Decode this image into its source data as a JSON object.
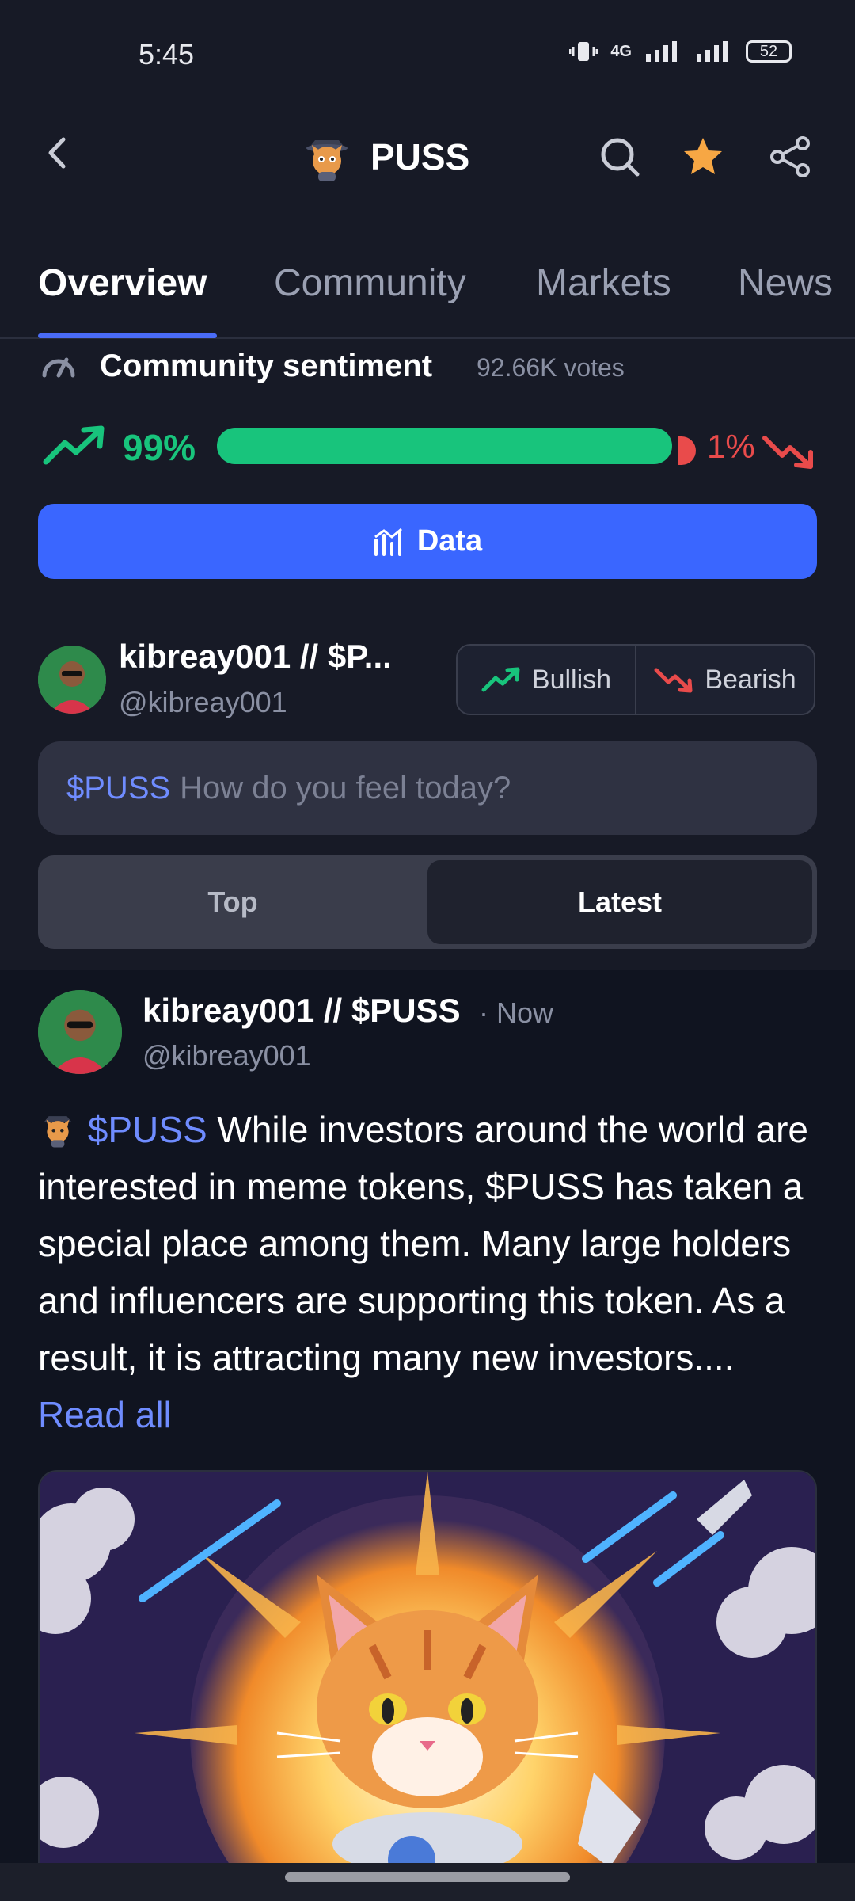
{
  "status": {
    "time": "5:45",
    "network": "4G",
    "battery": "52"
  },
  "header": {
    "title": "PUSS"
  },
  "tabs": [
    "Overview",
    "Community",
    "Markets",
    "News"
  ],
  "sentiment": {
    "title": "Community sentiment",
    "votes": "92.66K votes",
    "bullish_pct": "99%",
    "bearish_pct": "1%",
    "bullish_fraction": 0.99
  },
  "data_button": "Data",
  "composer": {
    "user_name": "kibreay001 // $P...",
    "user_handle": "@kibreay001",
    "bullish_label": "Bullish",
    "bearish_label": "Bearish",
    "tag": "$PUSS",
    "placeholder": "How do you feel today?"
  },
  "sort": {
    "top": "Top",
    "latest": "Latest",
    "selected": "Latest"
  },
  "post": {
    "user_name": "kibreay001 // $PUSS",
    "time": "· Now",
    "handle": "@kibreay001",
    "tag": "$PUSS",
    "text": " While investors around the world are interested in meme tokens, $PUSS has taken a special place among them. Many large holders and influencers are supporting this token. As a result, it is attracting many new investors.... ",
    "read_more": "Read all"
  },
  "colors": {
    "accent": "#3a66ff",
    "bullish": "#18c47c",
    "bearish": "#e94b4b",
    "link": "#6f8cff"
  },
  "icons": [
    "back-icon",
    "puss-logo-icon",
    "search-icon",
    "star-icon",
    "share-icon",
    "gauge-icon",
    "trend-up-icon",
    "trend-down-icon",
    "chart-icon"
  ]
}
